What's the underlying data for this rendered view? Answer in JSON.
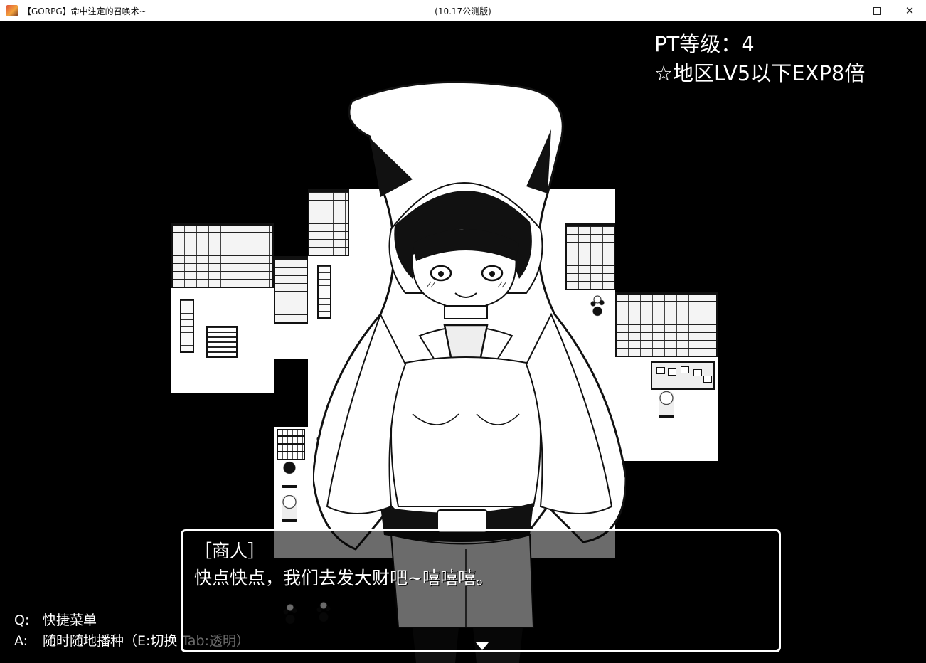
{
  "window": {
    "title": "【GORPG】命中注定的召唤术~",
    "subtitle": "(10.17公测版)",
    "controls": {
      "minimize": "—",
      "maximize": "☐",
      "close": "✕"
    }
  },
  "hud": {
    "party_level_label": "PT等级：",
    "party_level": "4",
    "bonus_text": "☆地区LV5以下EXP8倍"
  },
  "hints": [
    {
      "key": "Q:",
      "text": "快捷菜单"
    },
    {
      "key": "A:",
      "text": "随时随地播种（E:切换 Tab:透明）"
    }
  ],
  "dialogue": {
    "speaker": "［商人］",
    "message": "快点快点，我们去发大财吧~嘻嘻嘻。"
  },
  "icons": {
    "app": "game-app-icon",
    "continue": "continue-arrow-icon"
  },
  "colors": {
    "background": "#000000",
    "floor": "#ffffff",
    "text": "#ffffff",
    "window_border": "#ffffff"
  }
}
